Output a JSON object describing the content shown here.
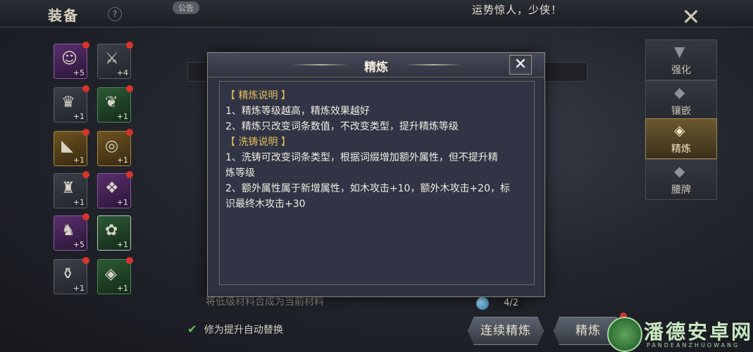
{
  "header": {
    "title": "装备",
    "help_icon": "?",
    "notice_tag": "公告",
    "marquee_text": "运势惊人，少侠！"
  },
  "equipment": [
    {
      "level": "+5",
      "icon": "hero-portrait-icon",
      "quality": "purple"
    },
    {
      "level": "+4",
      "icon": "sword-icon",
      "quality": "blue"
    },
    {
      "level": "+1",
      "icon": "robe-icon",
      "quality": "gray"
    },
    {
      "level": "+1",
      "icon": "bracelet-icon",
      "quality": "green"
    },
    {
      "level": "+1",
      "icon": "boots-icon",
      "quality": "gold"
    },
    {
      "level": "+1",
      "icon": "ring-icon",
      "quality": "gold"
    },
    {
      "level": "+1",
      "icon": "helmet-icon",
      "quality": "gray"
    },
    {
      "level": "+1",
      "icon": "amulet-icon",
      "quality": "purple"
    },
    {
      "level": "+5",
      "icon": "armor-icon",
      "quality": "purple"
    },
    {
      "level": "+1",
      "icon": "jade-pendant-icon",
      "quality": "green"
    },
    {
      "level": "+1",
      "icon": "belt-icon",
      "quality": "gray"
    },
    {
      "level": "+1",
      "icon": "token-icon",
      "quality": "green"
    }
  ],
  "tabs": [
    {
      "label": "强化",
      "icon": "anvil-icon",
      "active": false
    },
    {
      "label": "镶嵌",
      "icon": "gem-socket-icon",
      "active": false
    },
    {
      "label": "精炼",
      "icon": "refine-icon",
      "active": true
    },
    {
      "label": "腰牌",
      "icon": "waist-token-icon",
      "active": false
    }
  ],
  "background": {
    "bottom_hint": "将低级材料合成为当前材料",
    "auto_replace_label": "修为提升自动替换",
    "material_count": "4/2",
    "continuous_refine_button": "连续精炼",
    "refine_button": "精炼"
  },
  "modal": {
    "title": "精炼",
    "lines": [
      {
        "text": "【 精炼说明 】",
        "style": "gold"
      },
      {
        "text": "1、精炼等级越高，精炼效果越好",
        "style": "normal"
      },
      {
        "text": "2、精炼只改变词条数值，不改变类型，提升精炼等级",
        "style": "normal"
      },
      {
        "text": "【 洗铸说明 】",
        "style": "gold"
      },
      {
        "text": "1、洗铸可改变词条类型，根据词缀增加额外属性，但不提升精",
        "style": "normal"
      },
      {
        "text": "炼等级",
        "style": "normal"
      },
      {
        "text": "2、额外属性属于新增属性，如木攻击+10，额外木攻击+20，标",
        "style": "normal"
      },
      {
        "text": "识最终木攻击+30",
        "style": "normal"
      }
    ]
  },
  "watermark": {
    "brand": "潘德安卓网",
    "sub": "PANDEANZHUOWANG"
  },
  "colors": {
    "gold_heading": "#e8bf5a",
    "badge_red": "#d8342b",
    "active_tab": "#6b5830"
  }
}
